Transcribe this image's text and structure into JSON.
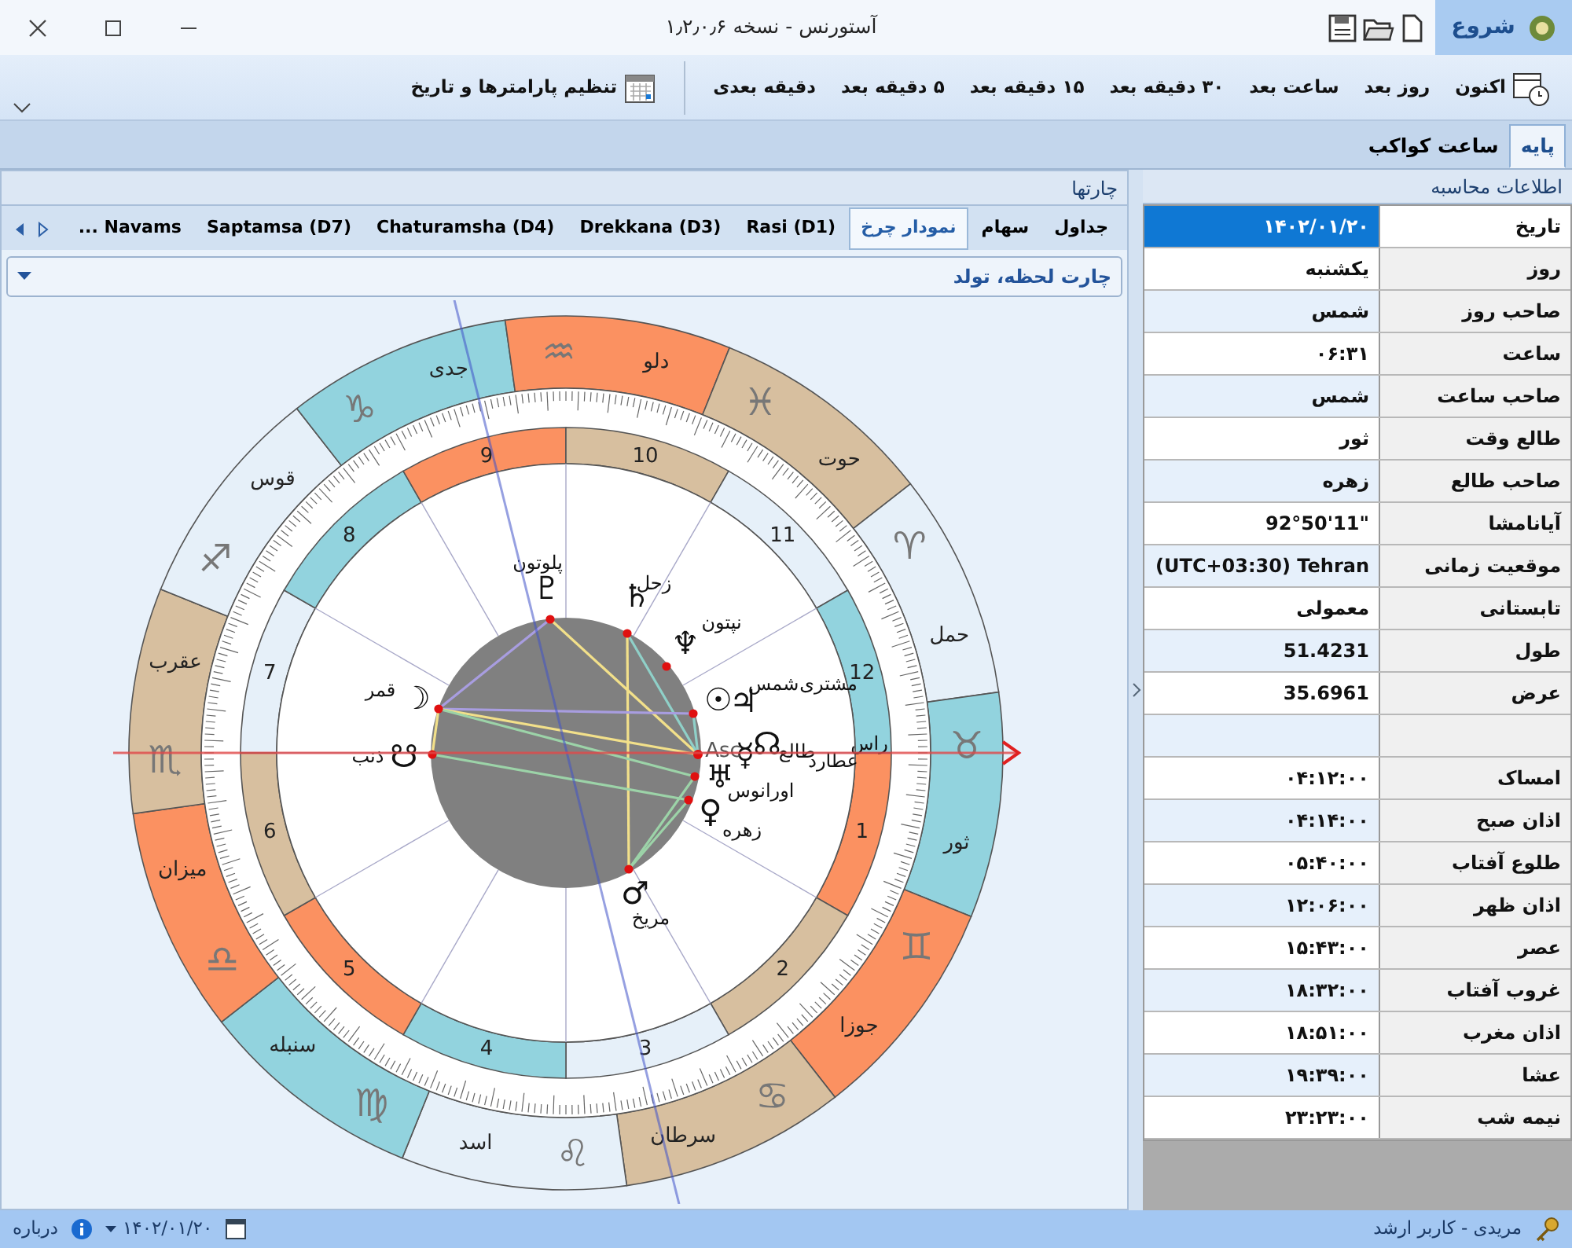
{
  "window": {
    "title": "آستورنس - نسخه ۱٫۲٫۰٫۶",
    "app_tab": "شروع"
  },
  "ribbon": {
    "buttons": [
      {
        "label": "اکنون",
        "kind": "now"
      },
      {
        "label": "روز بعد",
        "kind": "step"
      },
      {
        "label": "ساعت بعد",
        "kind": "step"
      },
      {
        "label": "۳۰ دقیقه بعد",
        "kind": "step"
      },
      {
        "label": "۱۵ دقیقه بعد",
        "kind": "step"
      },
      {
        "label": "۵ دقیقه بعد",
        "kind": "step"
      },
      {
        "label": "دقیقه بعدی",
        "kind": "step"
      },
      {
        "label": "تنظیم پارامترها و تاریخ",
        "kind": "settings"
      }
    ]
  },
  "tabs": [
    {
      "label": "پایه",
      "selected": true
    },
    {
      "label": "ساعت کواکب",
      "selected": false
    }
  ],
  "info_panel": {
    "title": "اطلاعات محاسبه",
    "rows": [
      {
        "kind": "data",
        "label": "تاریخ",
        "value": "۱۴۰۲/۰۱/۲۰",
        "selected": true
      },
      {
        "kind": "data",
        "label": "روز",
        "value": "یکشنبه",
        "selected": false
      },
      {
        "kind": "data",
        "label": "صاحب روز",
        "value": "شمس",
        "selected": false
      },
      {
        "kind": "data",
        "label": "ساعت",
        "value": "۰۶:۳۱",
        "selected": false
      },
      {
        "kind": "data",
        "label": "صاحب ساعت",
        "value": "شمس",
        "selected": false
      },
      {
        "kind": "data",
        "label": "طالع وقت",
        "value": "ثور",
        "selected": false
      },
      {
        "kind": "data",
        "label": "صاحب طالع",
        "value": "زهره",
        "selected": false
      },
      {
        "kind": "data",
        "label": "آیانامشا",
        "value": "92°50'11\"",
        "selected": false
      },
      {
        "kind": "data",
        "label": "موقعیت زمانی",
        "value": "(UTC+03:30) Tehran",
        "selected": false
      },
      {
        "kind": "data",
        "label": "تابستانی",
        "value": "معمولی",
        "selected": false
      },
      {
        "kind": "data",
        "label": "طول",
        "value": "51.4231",
        "selected": false
      },
      {
        "kind": "data",
        "label": "عرض",
        "value": "35.6961",
        "selected": false
      },
      {
        "kind": "blank",
        "selected": false
      },
      {
        "kind": "data",
        "label": "امساک",
        "value": "۰۴:۱۲:۰۰",
        "selected": false
      },
      {
        "kind": "data",
        "label": "اذان صبح",
        "value": "۰۴:۱۴:۰۰",
        "selected": false
      },
      {
        "kind": "data",
        "label": "طلوع آفتاب",
        "value": "۰۵:۴۰:۰۰",
        "selected": false
      },
      {
        "kind": "data",
        "label": "اذان ظهر",
        "value": "۱۲:۰۶:۰۰",
        "selected": false
      },
      {
        "kind": "data",
        "label": "عصر",
        "value": "۱۵:۴۳:۰۰",
        "selected": false
      },
      {
        "kind": "data",
        "label": "غروب آفتاب",
        "value": "۱۸:۳۲:۰۰",
        "selected": false
      },
      {
        "kind": "data",
        "label": "اذان مغرب",
        "value": "۱۸:۵۱:۰۰",
        "selected": false
      },
      {
        "kind": "data",
        "label": "عشا",
        "value": "۱۹:۳۹:۰۰",
        "selected": false
      },
      {
        "kind": "data",
        "label": "نیمه شب",
        "value": "۲۳:۲۳:۰۰",
        "selected": false
      }
    ]
  },
  "charts_panel": {
    "title": "چارتها",
    "tabs": [
      {
        "label": "جداول",
        "selected": false
      },
      {
        "label": "سهام",
        "selected": false
      },
      {
        "label": "نمودار چرخ",
        "selected": true
      },
      {
        "label": "Rasi (D1)",
        "selected": false
      },
      {
        "label": "Drekkana (D3)",
        "selected": false
      },
      {
        "label": "Chaturamsha (D4)",
        "selected": false
      },
      {
        "label": "Saptamsa (D7)",
        "selected": false
      },
      {
        "label": "Navams ...",
        "selected": false
      }
    ],
    "selector": "چارت لحظه، تولد",
    "wheel": {
      "signs": [
        {
          "name": "حمل",
          "glyph": "♈",
          "color": "#e6f0f9"
        },
        {
          "name": "ثور",
          "glyph": "♉",
          "color": "#92d3de"
        },
        {
          "name": "جوزا",
          "glyph": "♊",
          "color": "#fb9161"
        },
        {
          "name": "سرطان",
          "glyph": "♋",
          "color": "#d7bf9f"
        },
        {
          "name": "اسد",
          "glyph": "♌",
          "color": "#e6f0f9"
        },
        {
          "name": "سنبله",
          "glyph": "♍",
          "color": "#92d3de"
        },
        {
          "name": "میزان",
          "glyph": "♎",
          "color": "#fb9161"
        },
        {
          "name": "عقرب",
          "glyph": "♏",
          "color": "#d7bf9f"
        },
        {
          "name": "قوس",
          "glyph": "♐",
          "color": "#e6f0f9"
        },
        {
          "name": "جدی",
          "glyph": "♑",
          "color": "#92d3de"
        },
        {
          "name": "دلو",
          "glyph": "♒",
          "color": "#fb9161"
        },
        {
          "name": "حوت",
          "glyph": "♓",
          "color": "#d7bf9f"
        }
      ],
      "houses": [
        {
          "number": "1",
          "color": "#fb9161"
        },
        {
          "number": "2",
          "color": "#d7bf9f"
        },
        {
          "number": "3",
          "color": "#e6f0f9"
        },
        {
          "number": "4",
          "color": "#92d3de"
        },
        {
          "number": "5",
          "color": "#fb9161"
        },
        {
          "number": "6",
          "color": "#d7bf9f"
        },
        {
          "number": "7",
          "color": "#e6f0f9"
        },
        {
          "number": "8",
          "color": "#92d3de"
        },
        {
          "number": "9",
          "color": "#fb9161"
        },
        {
          "number": "10",
          "color": "#d7bf9f"
        },
        {
          "number": "11",
          "color": "#e6f0f9"
        },
        {
          "number": "12",
          "color": "#92d3de"
        }
      ],
      "ascendant": {
        "symbol": "Asc",
        "name": "طالع"
      },
      "planets": [
        {
          "name": "زحل",
          "glyph": "♄"
        },
        {
          "name": "پلوتون",
          "glyph": "♇"
        },
        {
          "name": "نپتون",
          "glyph": "♆"
        },
        {
          "name": "مشتری",
          "glyph": "♃"
        },
        {
          "name": "شمس",
          "glyph": "☉"
        },
        {
          "name": "قمر",
          "glyph": "☽"
        },
        {
          "name": "راس",
          "glyph": "☊"
        },
        {
          "name": "عطارد",
          "glyph": "☿"
        },
        {
          "name": "ذنب",
          "glyph": "☋"
        },
        {
          "name": "اورانوس",
          "glyph": "♅"
        },
        {
          "name": "زهره",
          "glyph": "♀"
        },
        {
          "name": "مریخ",
          "glyph": "♂"
        }
      ]
    }
  },
  "status_bar": {
    "user": "مریدی - کاربر ارشد",
    "date": "۱۴۰۲/۰۱/۲۰",
    "about": "درباره"
  }
}
